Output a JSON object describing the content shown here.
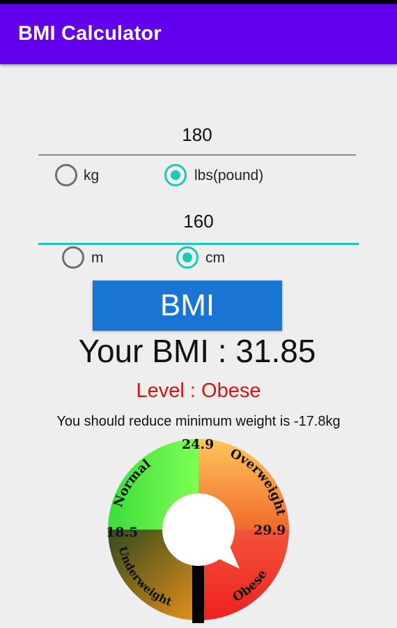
{
  "app": {
    "title": "BMI Calculator"
  },
  "weight": {
    "value": "180",
    "units": [
      {
        "label": "kg",
        "selected": false
      },
      {
        "label": "lbs(pound)",
        "selected": true
      }
    ]
  },
  "height": {
    "value": "160",
    "units": [
      {
        "label": "m",
        "selected": false
      },
      {
        "label": "cm",
        "selected": true
      }
    ]
  },
  "calculate_button": "BMI",
  "result": {
    "bmi_text": "Your BMI : 31.85",
    "level_text": "Level : Obese",
    "advice_text": "You should reduce minimum weight is -17.8kg"
  },
  "gauge": {
    "segments": [
      "Normal",
      "Overweight",
      "Obese",
      "Underweight"
    ],
    "thresholds": [
      "24.9",
      "29.9",
      "18.5"
    ],
    "bmi_value": 31.85,
    "colors": {
      "accent": "#1ec8b8",
      "app_bar": "#6200ee",
      "button": "#1a74d2",
      "level": "#dd1111"
    }
  }
}
